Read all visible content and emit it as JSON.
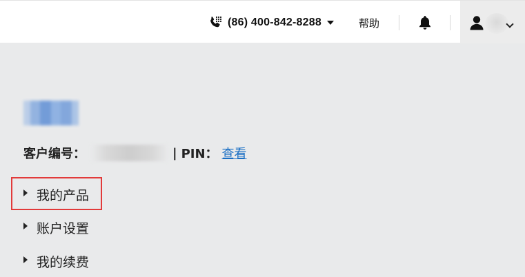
{
  "header": {
    "phone_number": "(86) 400-842-8288",
    "help_label": "帮助",
    "icons": {
      "phone": "phone-icon",
      "phone_dropdown": "caret-down-icon",
      "notifications": "bell-icon",
      "account": "user-icon",
      "account_dropdown": "chevron-down-icon"
    }
  },
  "account": {
    "customer_id_label": "客户编号：",
    "separator": "|",
    "pin_label": "PIN：",
    "pin_link": "查看"
  },
  "menu": {
    "items": [
      {
        "label": "我的产品",
        "highlighted": true
      },
      {
        "label": "账户设置",
        "highlighted": false
      },
      {
        "label": "我的续费",
        "highlighted": false
      }
    ]
  },
  "colors": {
    "page_background": "#e9eaeb",
    "header_background": "#ffffff",
    "link": "#1a6fc4",
    "highlight_border": "#e23a3a"
  }
}
